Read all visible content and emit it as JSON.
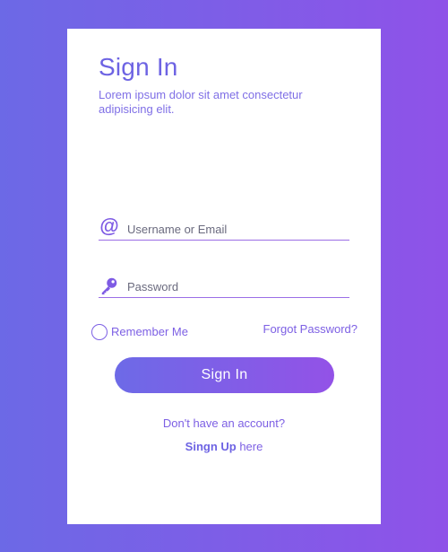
{
  "colors": {
    "gradient_start": "#6c69e6",
    "gradient_end": "#8f52e8",
    "accent": "#7d60e4",
    "card_bg": "#ffffff"
  },
  "header": {
    "title": "Sign In",
    "subtitle": "Lorem ipsum dolor sit amet consectetur adipisicing elit."
  },
  "form": {
    "username": {
      "placeholder": "Username or Email",
      "value": "",
      "icon": "at-icon"
    },
    "password": {
      "placeholder": "Password",
      "value": "",
      "icon": "key-icon"
    },
    "remember_label": "Remember Me",
    "forgot_label": "Forgot Password?",
    "submit_label": "Sign In"
  },
  "footer": {
    "no_account_text": "Don't have an account?",
    "signup_link": "Singn Up",
    "signup_suffix": " here"
  }
}
